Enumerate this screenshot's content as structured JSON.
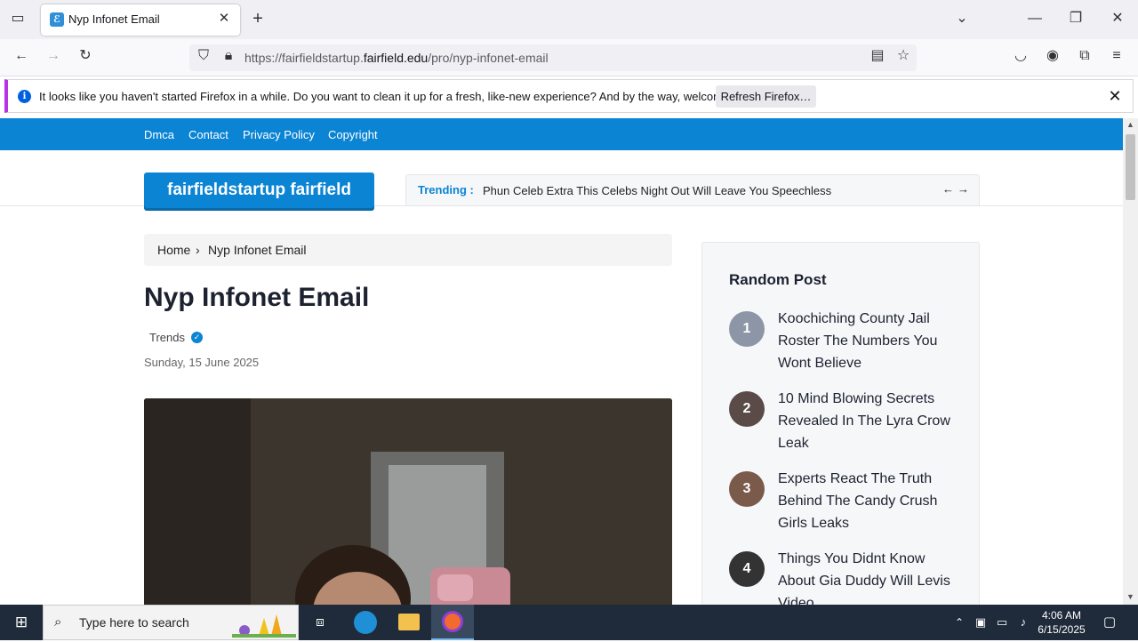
{
  "browser": {
    "tab_title": "Nyp Infonet Email",
    "url_prefix": "https://fairfieldstartup.",
    "url_domain": "fairfield.edu",
    "url_path": "/pro/nyp-infonet-email",
    "notification": "It looks like you haven't started Firefox in a while. Do you want to clean it up for a fresh, like-new experience? And by the way, welcome back!",
    "refresh_button": "Refresh Firefox…"
  },
  "site": {
    "nav": [
      "Dmca",
      "Contact",
      "Privacy Policy",
      "Copyright"
    ],
    "logo": "fairfieldstartup fairfield",
    "trending_label": "Trending :",
    "trending_text": "Phun Celeb Extra This Celebs Night Out Will Leave You Speechless",
    "breadcrumb": {
      "home": "Home",
      "sep": "›",
      "current": "Nyp Infonet Email"
    },
    "title": "Nyp Infonet Email",
    "category": "Trends",
    "date": "Sunday, 15 June 2025"
  },
  "sidebar": {
    "heading": "Random Post",
    "posts": [
      {
        "num": "1",
        "title": "Koochiching County Jail Roster The Numbers You Wont Believe",
        "color": "#8d96a6"
      },
      {
        "num": "2",
        "title": "10 Mind Blowing Secrets Revealed In The Lyra Crow Leak",
        "color": "#5a4a48"
      },
      {
        "num": "3",
        "title": "Experts React The Truth Behind The Candy Crush Girls Leaks",
        "color": "#7a5a4a"
      },
      {
        "num": "4",
        "title": "Things You Didnt Know About Gia Duddy Will Levis Video",
        "color": "#333333"
      }
    ]
  },
  "taskbar": {
    "search_placeholder": "Type here to search",
    "time": "4:06 AM",
    "date": "6/15/2025"
  }
}
